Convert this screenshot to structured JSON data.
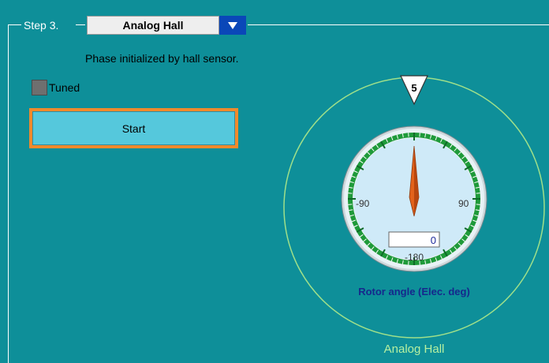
{
  "step": {
    "label": "Step 3.",
    "dropdown_value": "Analog Hall",
    "dropdown_icon": "triangle-down-icon",
    "description": "Phase initialized by hall sensor."
  },
  "tuned": {
    "label": "Tuned",
    "checked": false
  },
  "start_button": {
    "label": "Start"
  },
  "gauge": {
    "marker_value": "5",
    "readout_value": "0",
    "needle_angle_deg": 0,
    "labels": {
      "left": "-90",
      "right": "90",
      "bottom": "-180"
    },
    "caption": "Rotor angle (Elec. deg)",
    "footer": "Analog Hall"
  },
  "colors": {
    "background": "#0e8f99",
    "orange_focus": "#f08a2c",
    "button": "#55c8dc",
    "dropdown_arrow_bg": "#0a47b8",
    "gauge_ring_green": "#1f9a3a",
    "gauge_face": "#cfeaf8",
    "outer_circle": "#9fe08a",
    "caption": "#16288c",
    "needle": "#e2621b"
  }
}
